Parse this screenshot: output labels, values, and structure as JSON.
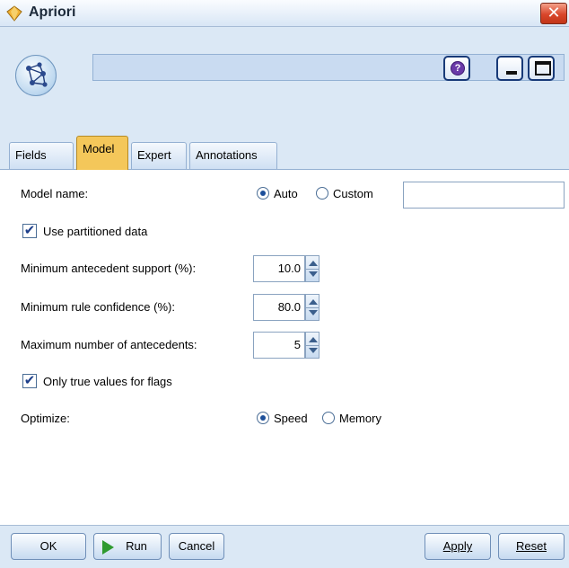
{
  "window": {
    "title": "Apriori",
    "close_glyph": "✕"
  },
  "header": {
    "help_glyph": "?"
  },
  "tabs": [
    {
      "label": "Fields",
      "active": false
    },
    {
      "label": "Model",
      "active": true
    },
    {
      "label": "Expert",
      "active": false
    },
    {
      "label": "Annotations",
      "active": false
    }
  ],
  "model_name": {
    "label": "Model name:",
    "options": [
      {
        "label": "Auto",
        "selected": true
      },
      {
        "label": "Custom",
        "selected": false
      }
    ],
    "custom_value": ""
  },
  "use_partitioned": {
    "label": "Use partitioned data",
    "checked": true
  },
  "min_antecedent_support": {
    "label": "Minimum antecedent support (%):",
    "value": "10.0"
  },
  "min_rule_confidence": {
    "label": "Minimum rule confidence (%):",
    "value": "80.0"
  },
  "max_antecedents": {
    "label": "Maximum number of antecedents:",
    "value": "5"
  },
  "only_true_flags": {
    "label": "Only true values for flags",
    "checked": true
  },
  "optimize": {
    "label": "Optimize:",
    "options": [
      {
        "label": "Speed",
        "selected": true
      },
      {
        "label": "Memory",
        "selected": false
      }
    ]
  },
  "footer": {
    "ok": "OK",
    "run": "Run",
    "cancel": "Cancel",
    "apply": "Apply",
    "reset": "Reset"
  },
  "check_glyph": "✔",
  "colors": {
    "active_tab": "#f4c75a",
    "background": "#dbe8f5",
    "run_icon": "#2f9a2f"
  }
}
